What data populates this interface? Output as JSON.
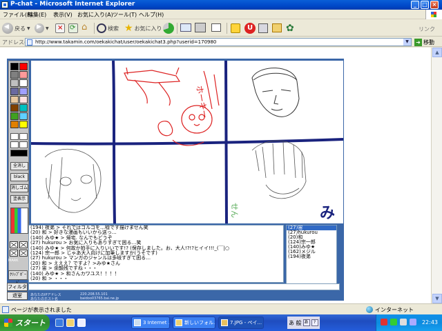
{
  "window": {
    "title": "P-chat - Microsoft Internet Explorer"
  },
  "menu": {
    "items": [
      "ファイル(F)",
      "編集(E)",
      "表示(V)",
      "お気に入り(A)",
      "ツール(T)",
      "ヘルプ(H)"
    ]
  },
  "toolbar": {
    "back_label": "戻る",
    "search_label": "検索",
    "favorites_label": "お気に入り",
    "links_label": "リンク"
  },
  "address": {
    "label": "アドレス(D)",
    "url": "http://www.takamin.com/oekakichat/user/oekakichat3.php?userid=170980",
    "go_label": "移動"
  },
  "palette": {
    "colors": [
      "#000000",
      "#ff0000",
      "#808080",
      "#ff9a9a",
      "#c0c0c0",
      "#ffffff",
      "#6a6aa0",
      "#a0a0ff",
      "#e8c8a0",
      "#ffe0e0",
      "#804000",
      "#00c0c0",
      "#40a020",
      "#60d0ff",
      "#e08000",
      "#ffff00",
      "#ffff00",
      "#ffffff"
    ],
    "tools": [
      "全消し",
      "black",
      "消しゴム",
      "塗表示"
    ],
    "mark_label": "MARK",
    "clip_label": "ｸﾘｯﾌﾟﾎﾞｰﾄﾞ"
  },
  "canvas": {
    "doodle_text_1": "せん",
    "doodle_text_2": "み",
    "doodle_text_3": "ホーキー"
  },
  "chat": {
    "lines": [
      "(194) 夜弟 > それではゴルゴを…嘘です描けません笑",
      "(20) 和 > 好きな漫画もいいから送っ…",
      "(140) みゆ★ > 帰宅. なんでもどうぞ",
      "(27) hukurou > お気に入りもありすぎて困る…笑",
      "(140) みゆ★ > 何故か拍手に入りいいです!? (保存しました。お、大人!?!?ヒイイ!!!_(￣|○",
      "(124) 宗一郎 > じゃあ大人向けに加筆しますか(うそです)",
      "(27) hukurou > マンガのジャンルは多岐すぎて困る…",
      "(20) 和 > えええ？ですよ？>みゆ★さん",
      "(27) 宙 > 余韻残ですね・・・",
      "(140) みゆ★ > 和さんカワユス！！！！",
      "(20) 和 > ・・・"
    ],
    "filter_label": "フィルタ",
    "exit_label": "退室",
    "ip_label": "あなたのIPアドレス",
    "ip_value": "220.208.55.101",
    "host_label": "あなたのホスト名",
    "host_value": "baidoo03765.bai.ne.jp"
  },
  "users": {
    "list": [
      "(27)宙",
      "(27)hukurou",
      "(20)和",
      "(124)宗一郎",
      "(140)みゆ★",
      "(162)メジル",
      "(194)夜弟"
    ]
  },
  "status": {
    "text": "ページが表示されました",
    "zone": "インターネット"
  },
  "taskbar": {
    "start_label": "スタート",
    "tasks": [
      "3 Internet ...",
      "新しいフォル...",
      "7.JPG - ペイ..."
    ],
    "clock": "22:43",
    "lang_label": "あ 般"
  }
}
